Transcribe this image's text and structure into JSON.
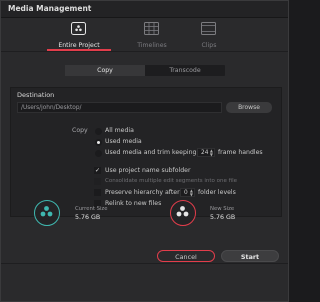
{
  "window": {
    "title": "Media Management"
  },
  "tabs": [
    {
      "label": "Entire Project",
      "icon": "project-icon",
      "active": true
    },
    {
      "label": "Timelines",
      "icon": "timelines-icon",
      "active": false
    },
    {
      "label": "Clips",
      "icon": "clips-icon",
      "active": false
    }
  ],
  "mode": {
    "options": [
      "Copy",
      "Transcode"
    ],
    "selected": "Copy"
  },
  "destination": {
    "label": "Destination",
    "path": "/Users/john/Desktop/",
    "browse_label": "Browse"
  },
  "copy": {
    "label": "Copy",
    "options": [
      {
        "label": "All media",
        "selected": false
      },
      {
        "label": "Used media",
        "selected": true
      },
      {
        "label_before": "Used media and trim keeping",
        "value": "24",
        "label_after": "frame handles",
        "selected": false
      }
    ]
  },
  "checkboxes": {
    "use_subfolder": {
      "label": "Use project name subfolder",
      "checked": true
    },
    "consolidate": {
      "label": "Consolidate multiple edit segments into one file",
      "checked": false,
      "disabled": true
    },
    "preserve": {
      "label_before": "Preserve hierarchy after",
      "value": "0",
      "label_after": "folder levels",
      "checked": false
    },
    "relink": {
      "label": "Relink to new files",
      "checked": false
    }
  },
  "sizes": {
    "current": {
      "title": "Current Size",
      "value": "5.76 GB",
      "color": "#3fb8b0"
    },
    "new": {
      "title": "New Size",
      "value": "5.76 GB",
      "color": "#e23d4b"
    }
  },
  "buttons": {
    "cancel": "Cancel",
    "start": "Start"
  },
  "colors": {
    "accent": "#e23d4b",
    "teal": "#3fb8b0",
    "background": "#2a2a2c"
  }
}
